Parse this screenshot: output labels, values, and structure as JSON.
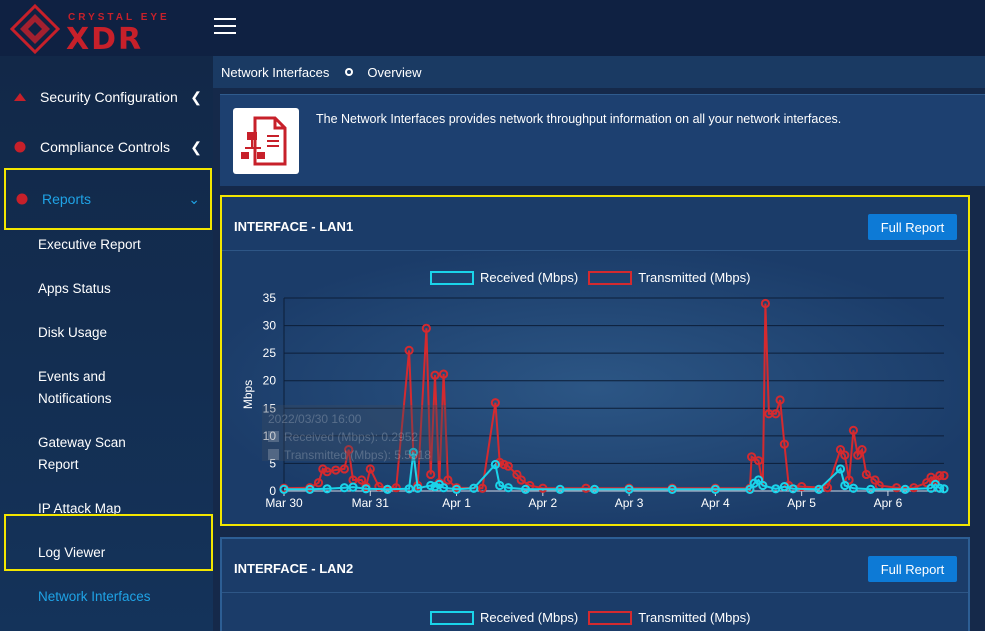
{
  "app": {
    "logo_small": "CRYSTAL EYE",
    "logo_main": "XDR"
  },
  "colors": {
    "accent": "#1fa3e6",
    "highlight": "#f3e600",
    "brand_red": "#c7202a",
    "received": "#1ad4ea",
    "transmitted": "#d42a2f",
    "button": "#0d7ad6"
  },
  "sidebar": {
    "main_items": [
      {
        "label": "Security Configuration",
        "icon": "triangle-icon",
        "chevron": "chevron-left-icon"
      },
      {
        "label": "Compliance Controls",
        "icon": "circle-icon",
        "chevron": "chevron-left-icon"
      },
      {
        "label": "Reports",
        "icon": "circle-icon",
        "chevron": "chevron-down-icon",
        "active": true
      }
    ],
    "sub_items": [
      {
        "label": "Executive Report"
      },
      {
        "label": "Apps Status"
      },
      {
        "label": "Disk Usage"
      },
      {
        "label": "Events and Notifications",
        "line1": "Events and",
        "line2": "Notifications"
      },
      {
        "label": "Gateway Scan Report",
        "line1": "Gateway Scan",
        "line2": "Report"
      },
      {
        "label": "IP Attack Map"
      },
      {
        "label": "Log Viewer"
      },
      {
        "label": "Network Interfaces",
        "active": true
      }
    ]
  },
  "breadcrumb": {
    "items": [
      "Network Interfaces",
      "Overview"
    ]
  },
  "info": {
    "text": "The Network Interfaces provides network throughput information on all your network interfaces."
  },
  "panels": [
    {
      "title": "INTERFACE - LAN1",
      "button": "Full Report"
    },
    {
      "title": "INTERFACE - LAN2",
      "button": "Full Report"
    }
  ],
  "tooltip": {
    "title": "2022/03/30 16:00",
    "received": "Received (Mbps): 0.2952",
    "transmitted": "Transmitted (Mbps): 5.5518"
  },
  "chart_data": {
    "type": "line",
    "ylabel": "Mbps",
    "ylim": [
      0,
      35
    ],
    "yticks": [
      0,
      5,
      10,
      15,
      20,
      25,
      30,
      35
    ],
    "xticks": [
      "Mar 30",
      "Mar 31",
      "Apr 1",
      "Apr 2",
      "Apr 3",
      "Apr 4",
      "Apr 5",
      "Apr 6"
    ],
    "xlim": [
      0,
      7.65
    ],
    "legend": "top-center",
    "grid": true,
    "series": [
      {
        "name": "Received (Mbps)",
        "color": "#1ad4ea",
        "points": [
          [
            0,
            0.3
          ],
          [
            0.3,
            0.3
          ],
          [
            0.5,
            0.4
          ],
          [
            0.7,
            0.6
          ],
          [
            0.8,
            0.7
          ],
          [
            0.95,
            0.4
          ],
          [
            1.2,
            0.3
          ],
          [
            1.45,
            0.4
          ],
          [
            1.5,
            7
          ],
          [
            1.55,
            0.5
          ],
          [
            1.7,
            1
          ],
          [
            1.75,
            0.8
          ],
          [
            1.8,
            1.2
          ],
          [
            1.85,
            0.6
          ],
          [
            2.0,
            0.3
          ],
          [
            2.2,
            0.5
          ],
          [
            2.45,
            4.8
          ],
          [
            2.5,
            1
          ],
          [
            2.6,
            0.6
          ],
          [
            2.8,
            0.3
          ],
          [
            3.2,
            0.3
          ],
          [
            3.6,
            0.3
          ],
          [
            4.0,
            0.3
          ],
          [
            4.5,
            0.3
          ],
          [
            5.0,
            0.3
          ],
          [
            5.4,
            0.3
          ],
          [
            5.45,
            1.4
          ],
          [
            5.5,
            2
          ],
          [
            5.55,
            1
          ],
          [
            5.7,
            0.4
          ],
          [
            5.8,
            0.8
          ],
          [
            5.9,
            0.4
          ],
          [
            6.2,
            0.3
          ],
          [
            6.45,
            4
          ],
          [
            6.5,
            1
          ],
          [
            6.6,
            0.5
          ],
          [
            6.8,
            0.3
          ],
          [
            7.2,
            0.3
          ],
          [
            7.5,
            0.5
          ],
          [
            7.55,
            1.2
          ],
          [
            7.6,
            0.5
          ],
          [
            7.65,
            0.4
          ]
        ]
      },
      {
        "name": "Transmitted (Mbps)",
        "color": "#d42a2f",
        "points": [
          [
            0,
            0.5
          ],
          [
            0.3,
            0.6
          ],
          [
            0.4,
            1.5
          ],
          [
            0.45,
            4
          ],
          [
            0.5,
            3.5
          ],
          [
            0.6,
            3.8
          ],
          [
            0.7,
            4
          ],
          [
            0.75,
            7.5
          ],
          [
            0.8,
            2
          ],
          [
            0.9,
            2
          ],
          [
            0.95,
            0.8
          ],
          [
            1.0,
            4
          ],
          [
            1.1,
            0.8
          ],
          [
            1.3,
            0.6
          ],
          [
            1.45,
            25.5
          ],
          [
            1.5,
            6.5
          ],
          [
            1.55,
            1
          ],
          [
            1.65,
            29.5
          ],
          [
            1.7,
            3
          ],
          [
            1.75,
            21
          ],
          [
            1.8,
            1.5
          ],
          [
            1.85,
            21.2
          ],
          [
            1.9,
            2
          ],
          [
            2.0,
            0.6
          ],
          [
            2.3,
            0.5
          ],
          [
            2.45,
            16
          ],
          [
            2.5,
            5.2
          ],
          [
            2.55,
            4.8
          ],
          [
            2.6,
            4.5
          ],
          [
            2.7,
            3
          ],
          [
            2.75,
            2
          ],
          [
            2.85,
            1
          ],
          [
            3.0,
            0.5
          ],
          [
            3.5,
            0.5
          ],
          [
            4.0,
            0.5
          ],
          [
            4.5,
            0.5
          ],
          [
            5.0,
            0.5
          ],
          [
            5.4,
            0.5
          ],
          [
            5.42,
            6.2
          ],
          [
            5.5,
            5.5
          ],
          [
            5.55,
            1
          ],
          [
            5.58,
            34
          ],
          [
            5.62,
            14
          ],
          [
            5.7,
            14
          ],
          [
            5.75,
            16.5
          ],
          [
            5.8,
            8.5
          ],
          [
            5.85,
            1
          ],
          [
            6.0,
            0.8
          ],
          [
            6.3,
            0.6
          ],
          [
            6.45,
            7.5
          ],
          [
            6.5,
            6.5
          ],
          [
            6.55,
            2
          ],
          [
            6.6,
            11
          ],
          [
            6.65,
            6.5
          ],
          [
            6.7,
            7.5
          ],
          [
            6.75,
            3
          ],
          [
            6.85,
            2
          ],
          [
            6.9,
            1
          ],
          [
            7.1,
            0.6
          ],
          [
            7.3,
            0.6
          ],
          [
            7.45,
            1.5
          ],
          [
            7.5,
            2.5
          ],
          [
            7.55,
            2
          ],
          [
            7.6,
            2.8
          ],
          [
            7.65,
            2.8
          ]
        ]
      }
    ]
  }
}
